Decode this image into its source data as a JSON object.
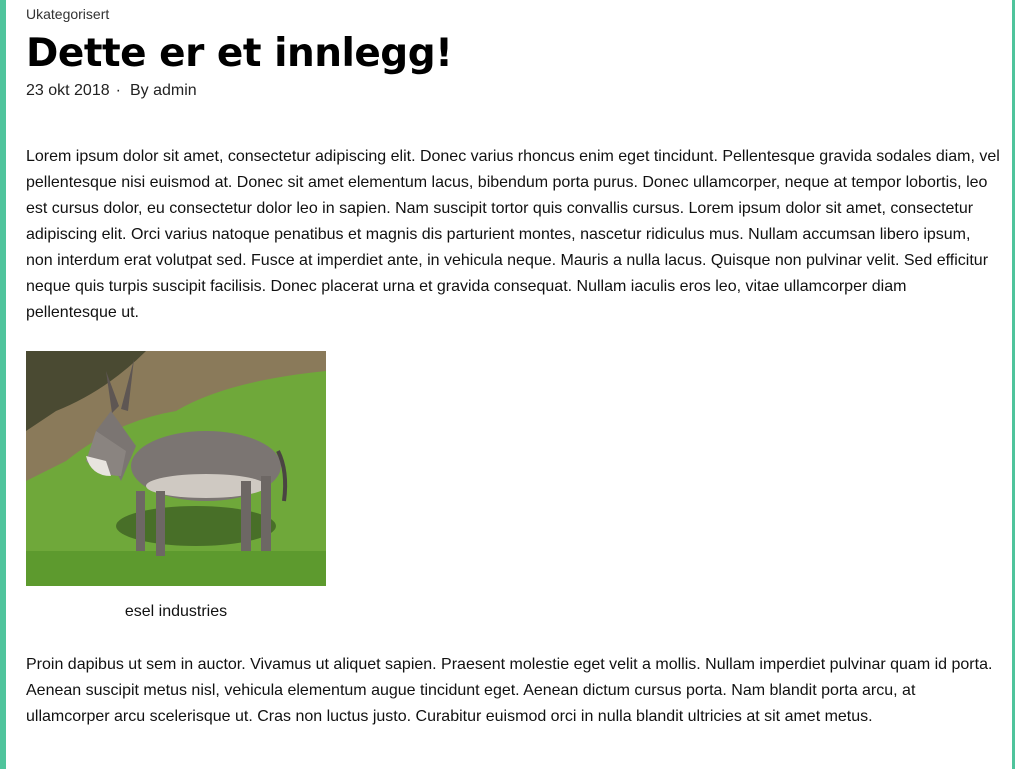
{
  "post": {
    "category": "Ukategorisert",
    "title": "Dette er et innlegg!",
    "date": "23 okt 2018",
    "separator": "·",
    "author_prefix": "By",
    "author": "admin",
    "paragraph_1": "Lorem ipsum dolor sit amet, consectetur adipiscing elit. Donec varius rhoncus enim eget tincidunt. Pellentesque gravida sodales diam, vel pellentesque nisi euismod at. Donec sit amet elementum lacus, bibendum porta purus. Donec ullamcorper, neque at tempor lobortis, leo est cursus dolor, eu consectetur dolor leo in sapien. Nam suscipit tortor quis convallis cursus. Lorem ipsum dolor sit amet, consectetur adipiscing elit. Orci varius natoque penatibus et magnis dis parturient montes, nascetur ridiculus mus. Nullam accumsan libero ipsum, non interdum erat volutpat sed. Fusce at imperdiet ante, in vehicula neque. Mauris a nulla lacus. Quisque non pulvinar velit. Sed efficitur neque quis turpis suscipit facilisis. Donec placerat urna et gravida consequat. Nullam iaculis eros leo, vitae ullamcorper diam pellentesque ut.",
    "image_caption": "esel industries",
    "paragraph_2": "Proin dapibus ut sem in auctor. Vivamus ut aliquet sapien. Praesent molestie eget velit a mollis. Nullam imperdiet pulvinar quam id porta. Aenean suscipit metus nisl, vehicula elementum augue tincidunt eget. Aenean dictum cursus porta. Nam blandit porta arcu, at ullamcorper arcu scelerisque ut. Cras non luctus justo. Curabitur euismod orci in nulla blandit ultricies at sit amet metus."
  },
  "colors": {
    "accent": "#4fc49c"
  }
}
